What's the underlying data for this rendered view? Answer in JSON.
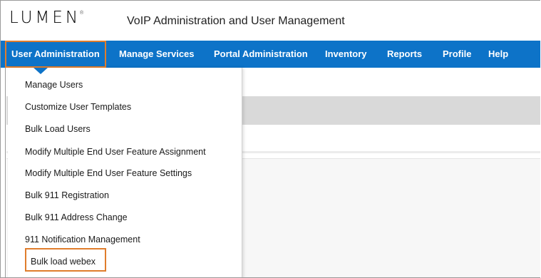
{
  "header": {
    "logo_text": "LUMEN",
    "logo_mark": "®",
    "app_title": "VoIP Administration and User Management"
  },
  "nav": {
    "items": [
      {
        "label": "User Administration",
        "active": true
      },
      {
        "label": "Manage Services"
      },
      {
        "label": "Portal Administration"
      },
      {
        "label": "Inventory"
      },
      {
        "label": "Reports"
      },
      {
        "label": "Profile"
      },
      {
        "label": "Help"
      }
    ]
  },
  "dropdown": {
    "items": [
      {
        "label": "Manage Users"
      },
      {
        "label": "Customize User Templates"
      },
      {
        "label": "Bulk Load Users"
      },
      {
        "label": "Modify Multiple End User Feature Assignment"
      },
      {
        "label": "Modify Multiple End User Feature Settings"
      },
      {
        "label": "Bulk 911 Registration"
      },
      {
        "label": "Bulk 911 Address Change"
      },
      {
        "label": "911 Notification Management"
      },
      {
        "label": "Bulk load webex",
        "highlighted": true
      }
    ]
  },
  "colors": {
    "nav_bg": "#0d73c8",
    "highlight": "#e07d2c"
  }
}
